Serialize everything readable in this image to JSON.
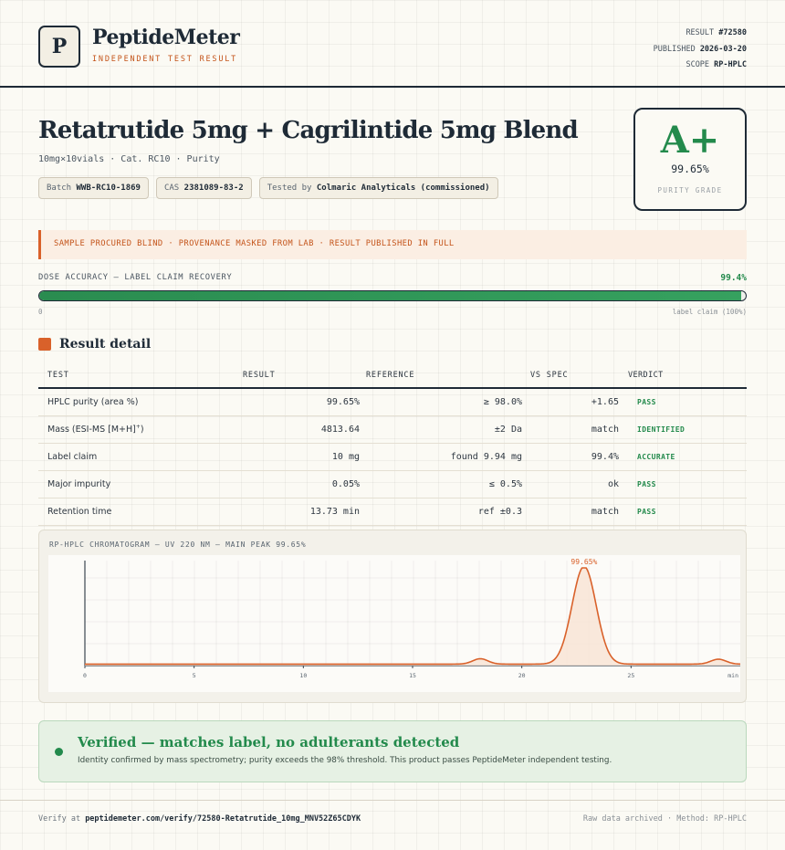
{
  "brand": {
    "logo_letter": "P",
    "name": "PeptideMeter",
    "tagline": "INDEPENDENT TEST RESULT"
  },
  "meta": {
    "result_label": "RESULT",
    "result_value": "#72580",
    "published_label": "PUBLISHED",
    "published_value": "2026-03-20",
    "scope_label": "SCOPE",
    "scope_value": "RP-HPLC"
  },
  "product": {
    "title": "Retatrutide 5mg + Cagrilintide 5mg Blend",
    "subtitle": "10mg×10vials · Cat. RC10 · Purity",
    "batch_label": "Batch",
    "batch_value": "WWB-RC10-1869",
    "cas_label": "CAS",
    "cas_value": "2381089-83-2",
    "tested_label": "Tested by",
    "tested_value": "Colmaric Analyticals (commissioned)"
  },
  "grade": {
    "letter": "A+",
    "value": "99.65%",
    "label": "PURITY GRADE"
  },
  "notice": "SAMPLE PROCURED BLIND · PROVENANCE MASKED FROM LAB · RESULT PUBLISHED IN FULL",
  "dose": {
    "label": "DOSE ACCURACY — LABEL CLAIM RECOVERY",
    "value_text": "99.4%",
    "fraction": 0.994,
    "min_label": "0",
    "max_label": "label claim (100%)"
  },
  "results": {
    "section_title": "Result detail",
    "headers": [
      "TEST",
      "RESULT",
      "REFERENCE",
      "VS SPEC",
      "VERDICT"
    ],
    "rows": [
      {
        "test": "HPLC purity (area %)",
        "sup": "",
        "result": "99.65%",
        "reference": "≥ 98.0%",
        "vs_spec": "+1.65",
        "verdict": "PASS"
      },
      {
        "test": "Mass (ESI-MS [M+H]",
        "sup": "+",
        "tail": ")",
        "result": "4813.64",
        "reference": "±2 Da",
        "vs_spec": "match",
        "verdict": "IDENTIFIED"
      },
      {
        "test": "Label claim",
        "sup": "",
        "result": "10 mg",
        "reference": "found 9.94 mg",
        "vs_spec": "99.4%",
        "verdict": "ACCURATE"
      },
      {
        "test": "Major impurity",
        "sup": "",
        "result": "0.05%",
        "reference": "≤ 0.5%",
        "vs_spec": "ok",
        "verdict": "PASS"
      },
      {
        "test": "Retention time",
        "sup": "",
        "result": "13.73 min",
        "reference": "ref ±0.3",
        "vs_spec": "match",
        "verdict": "PASS"
      }
    ]
  },
  "chart_data": {
    "type": "line",
    "title": "RP-HPLC CHROMATOGRAM — UV 220 NM — MAIN PEAK 99.65%",
    "xlabel": "",
    "ylabel": "",
    "x_unit_label": "min",
    "xlim": [
      0,
      30
    ],
    "x_ticks": [
      0,
      5,
      10,
      15,
      20,
      25
    ],
    "ylim": [
      0,
      100
    ],
    "peak_label": "99.65%",
    "peaks": [
      {
        "center": 18.1,
        "height": 5.5,
        "width": 0.35
      },
      {
        "center": 22.85,
        "height": 100,
        "width": 0.55
      },
      {
        "center": 29.0,
        "height": 5,
        "width": 0.35
      }
    ],
    "baseline": 1.5,
    "line_color": "#d9612a",
    "fill_color": "#f8e4d6"
  },
  "verified": {
    "title": "Verified — matches label, no adulterants detected",
    "text": "Identity confirmed by mass spectrometry; purity exceeds the 98% threshold. This product passes PeptideMeter independent testing."
  },
  "footer": {
    "verify_label": "Verify at",
    "verify_url": "peptidemeter.com/verify/72580-Retatrutide_10mg_MNV52Z65CDYK",
    "right_text": "Raw data archived · Method: RP-HPLC"
  }
}
